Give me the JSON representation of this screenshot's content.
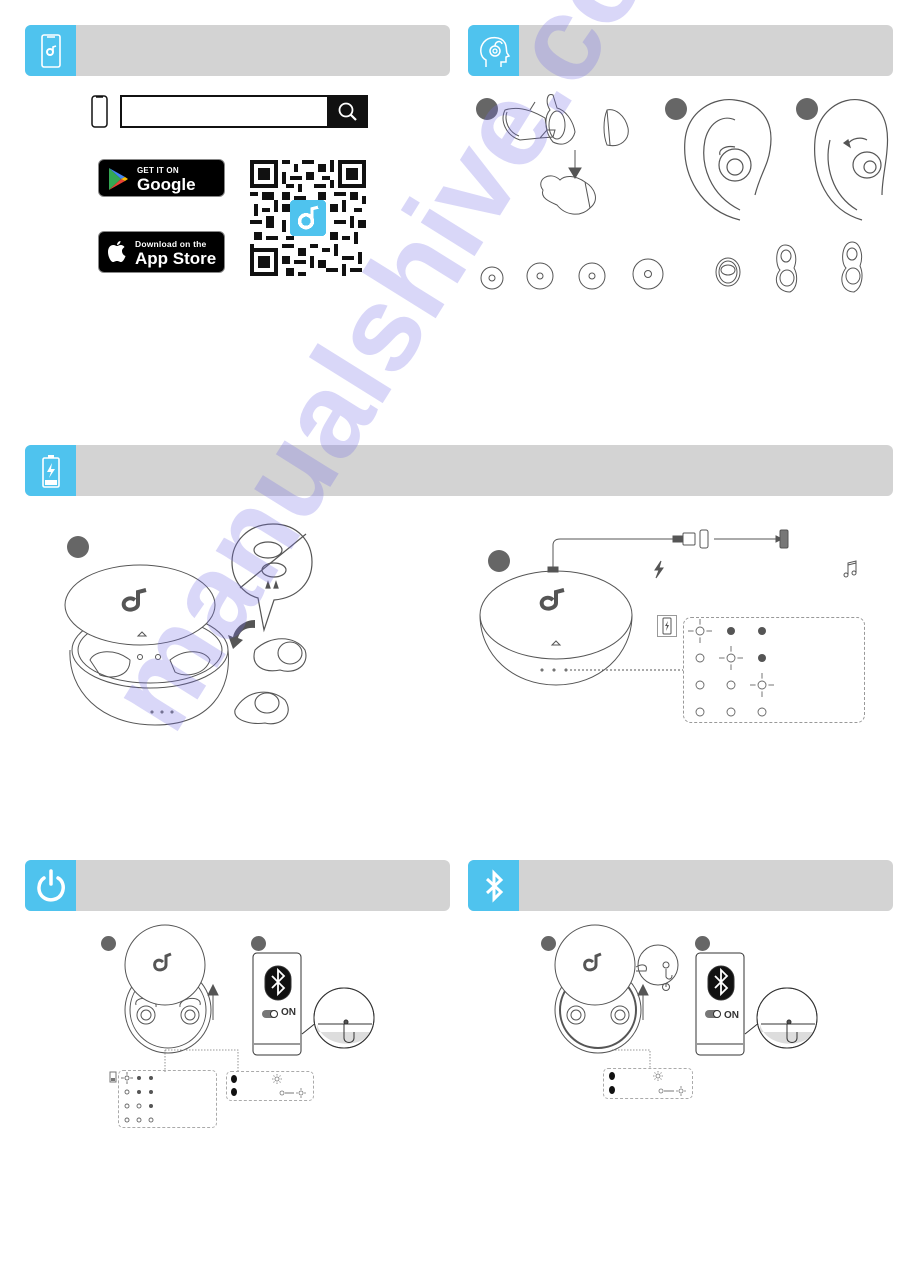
{
  "sections": {
    "app": {
      "title": "",
      "icon": "phone-app-icon",
      "search": {
        "value": "",
        "placeholder": ""
      },
      "google_play": {
        "small": "GET IT ON",
        "big": "Google Play"
      },
      "app_store": {
        "small": "Download on the",
        "big": "App Store"
      }
    },
    "wearing": {
      "title": "",
      "icon": "head-headphones-icon",
      "steps": [
        "",
        "",
        ""
      ],
      "ear_tip_sizes": 4,
      "ear_wing_sizes": 3
    },
    "charging": {
      "title": "",
      "icon": "battery-charging-icon",
      "steps": [
        "",
        ""
      ],
      "led_table": [
        [
          "blink",
          "on",
          "on"
        ],
        [
          "off",
          "blink",
          "on"
        ],
        [
          "off",
          "off",
          "blink"
        ],
        [
          "off",
          "off",
          "off"
        ]
      ]
    },
    "power_on": {
      "title": "",
      "icon": "power-icon",
      "steps": [
        "",
        ""
      ],
      "toggle_label": "ON",
      "battery_leds": [
        [
          "blink",
          "on",
          "on"
        ],
        [
          "off",
          "on",
          "on"
        ],
        [
          "off",
          "off",
          "on"
        ],
        [
          "off",
          "off",
          "off"
        ]
      ]
    },
    "pairing": {
      "title": "",
      "icon": "bluetooth-icon",
      "steps": [
        "",
        ""
      ],
      "toggle_label": "ON"
    }
  },
  "colors": {
    "accent": "#4fc3ee",
    "header_bg": "#d3d3d3",
    "step_badge": "#666666"
  },
  "watermark": "manualshive.com"
}
